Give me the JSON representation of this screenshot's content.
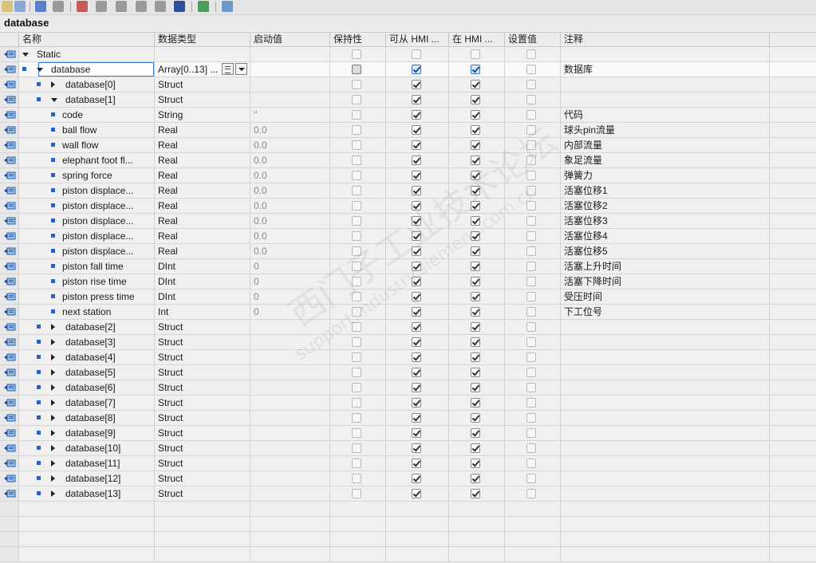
{
  "toolbar": {
    "icons": [
      "insert-row-icon",
      "add-row-icon",
      "add-block-icon",
      "edit-icon",
      "monitor-icon",
      "snapshot-icon",
      "load-snapshot-icon",
      "copy-icon",
      "copy-values-icon",
      "list-icon",
      "export-icon",
      "online-icon"
    ]
  },
  "block_title": "database",
  "columns": {
    "name": "名称",
    "type": "数据类型",
    "start": "启动值",
    "retain": "保持性",
    "hmi_access": "可从 HMI ...",
    "hmi_visible": "在 HMI ...",
    "setpoint": "设置值",
    "comment": "注释"
  },
  "rows": [
    {
      "name": "Static",
      "type": "",
      "start": "",
      "comment": ""
    },
    {
      "name": "database",
      "type": "Array[0..13] ...",
      "start": "",
      "comment": "数据库"
    },
    {
      "name": "database[0]",
      "type": "Struct",
      "start": "",
      "comment": ""
    },
    {
      "name": "database[1]",
      "type": "Struct",
      "start": "",
      "comment": ""
    },
    {
      "name": "code",
      "type": "String",
      "start": "''",
      "comment": "代码"
    },
    {
      "name": "ball flow",
      "type": "Real",
      "start": "0.0",
      "comment": "球头pin流量"
    },
    {
      "name": "wall flow",
      "type": "Real",
      "start": "0.0",
      "comment": "内部流量"
    },
    {
      "name": "elephant foot fl...",
      "type": "Real",
      "start": "0.0",
      "comment": "象足流量"
    },
    {
      "name": "spring force",
      "type": "Real",
      "start": "0.0",
      "comment": "弹簧力"
    },
    {
      "name": "piston displace...",
      "type": "Real",
      "start": "0.0",
      "comment": "活塞位移1"
    },
    {
      "name": "piston displace...",
      "type": "Real",
      "start": "0.0",
      "comment": "活塞位移2"
    },
    {
      "name": "piston displace...",
      "type": "Real",
      "start": "0.0",
      "comment": "活塞位移3"
    },
    {
      "name": "piston displace...",
      "type": "Real",
      "start": "0.0",
      "comment": "活塞位移4"
    },
    {
      "name": "piston displace...",
      "type": "Real",
      "start": "0.0",
      "comment": "活塞位移5"
    },
    {
      "name": "piston fall time",
      "type": "DInt",
      "start": "0",
      "comment": "活塞上升时间"
    },
    {
      "name": "piston rise time",
      "type": "DInt",
      "start": "0",
      "comment": "活塞下降时间"
    },
    {
      "name": "piston press time",
      "type": "DInt",
      "start": "0",
      "comment": "受压时间"
    },
    {
      "name": "next station",
      "type": "Int",
      "start": "0",
      "comment": "下工位号"
    },
    {
      "name": "database[2]",
      "type": "Struct",
      "start": "",
      "comment": ""
    },
    {
      "name": "database[3]",
      "type": "Struct",
      "start": "",
      "comment": ""
    },
    {
      "name": "database[4]",
      "type": "Struct",
      "start": "",
      "comment": ""
    },
    {
      "name": "database[5]",
      "type": "Struct",
      "start": "",
      "comment": ""
    },
    {
      "name": "database[6]",
      "type": "Struct",
      "start": "",
      "comment": ""
    },
    {
      "name": "database[7]",
      "type": "Struct",
      "start": "",
      "comment": ""
    },
    {
      "name": "database[8]",
      "type": "Struct",
      "start": "",
      "comment": ""
    },
    {
      "name": "database[9]",
      "type": "Struct",
      "start": "",
      "comment": ""
    },
    {
      "name": "database[10]",
      "type": "Struct",
      "start": "",
      "comment": ""
    },
    {
      "name": "database[11]",
      "type": "Struct",
      "start": "",
      "comment": ""
    },
    {
      "name": "database[12]",
      "type": "Struct",
      "start": "",
      "comment": ""
    },
    {
      "name": "database[13]",
      "type": "Struct",
      "start": "",
      "comment": ""
    }
  ],
  "watermark": {
    "line1": "西门子工业技术论坛",
    "line2": "support.industry.siemens.com.cn"
  },
  "colors": {
    "bullet": "#2f5fbf",
    "selection_border": "#3a7bd5"
  }
}
